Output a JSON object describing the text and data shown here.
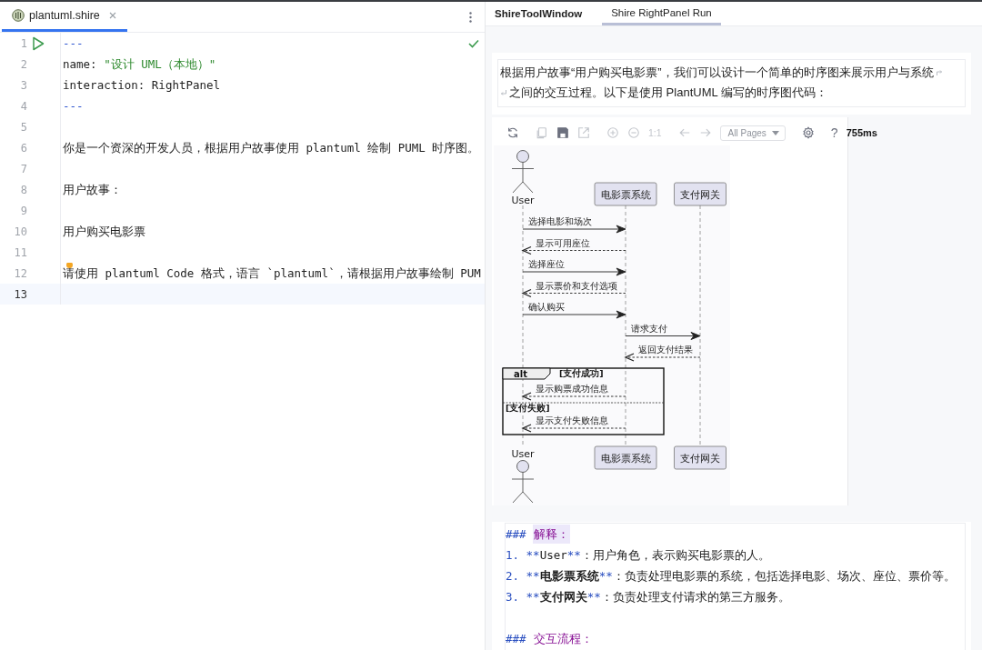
{
  "editor": {
    "tab": {
      "label": "plantuml.shire",
      "selected": true
    },
    "lines": [
      {
        "number": "1",
        "current": false,
        "run": true,
        "segments": [
          {
            "kind": "dashes",
            "text": "---"
          }
        ]
      },
      {
        "number": "2",
        "current": false,
        "run": false,
        "segments": [
          {
            "kind": "text",
            "text": "name: "
          },
          {
            "kind": "string",
            "text": "\"设计 UML（本地）\""
          }
        ]
      },
      {
        "number": "3",
        "current": false,
        "run": false,
        "segments": [
          {
            "kind": "text",
            "text": "interaction: RightPanel"
          }
        ]
      },
      {
        "number": "4",
        "current": false,
        "run": false,
        "segments": [
          {
            "kind": "dashes",
            "text": "---"
          }
        ]
      },
      {
        "number": "5",
        "current": false,
        "run": false
      },
      {
        "number": "6",
        "current": false,
        "run": false,
        "segments": [
          {
            "kind": "text",
            "text": "你是一个资深的开发人员，根据用户故事使用 plantuml 绘制 PUML 时序图。"
          }
        ]
      },
      {
        "number": "7",
        "current": false,
        "run": false
      },
      {
        "number": "8",
        "current": false,
        "run": false,
        "segments": [
          {
            "kind": "text",
            "text": "用户故事："
          }
        ]
      },
      {
        "number": "9",
        "current": false,
        "run": false
      },
      {
        "number": "10",
        "current": false,
        "run": false,
        "segments": [
          {
            "kind": "text",
            "text": "用户购买电影票"
          }
        ]
      },
      {
        "number": "11",
        "current": false,
        "run": false
      },
      {
        "number": "12",
        "current": false,
        "run": false,
        "segments": [
          {
            "kind": "text",
            "text": "请使用 plantuml Code 格式，语言 `plantuml`，请根据用户故事绘制 PUM"
          }
        ]
      },
      {
        "number": "13",
        "current": true,
        "run": false
      }
    ]
  },
  "panel": {
    "title": "ShireToolWindow",
    "tabs": [
      {
        "label": "Shire RightPanel Run",
        "selected": true
      }
    ],
    "message_lines": [
      "根据用户故事“用户购买电影票”，我们可以设计一个简单的时序图来展示用户与系统",
      "之间的交互过程。以下是使用 PlantUML 编写的时序图代码："
    ],
    "toolbar": [
      {
        "kind": "refresh",
        "disabled": false
      },
      {
        "kind": "separator"
      },
      {
        "kind": "copy",
        "disabled": true
      },
      {
        "kind": "save",
        "disabled": false
      },
      {
        "kind": "export",
        "disabled": true
      },
      {
        "kind": "separator"
      },
      {
        "kind": "zoom-in",
        "disabled": true
      },
      {
        "kind": "zoom-out",
        "disabled": true
      },
      {
        "kind": "text",
        "label": "1:1",
        "disabled": true
      },
      {
        "kind": "separator"
      },
      {
        "kind": "back",
        "disabled": true
      },
      {
        "kind": "forward",
        "disabled": true
      },
      {
        "kind": "dropdown",
        "label": "All Pages",
        "disabled": true
      },
      {
        "kind": "separator"
      },
      {
        "kind": "settings",
        "disabled": false
      },
      {
        "kind": "separator"
      },
      {
        "kind": "help",
        "label": "?",
        "disabled": false
      },
      {
        "kind": "time",
        "label": "755ms"
      }
    ],
    "diagram": {
      "participants": [
        {
          "kind": "actor",
          "name": "User",
          "footer_name": "User"
        },
        {
          "kind": "participant",
          "name": "电影票系统",
          "footer_name": "电影票系统"
        },
        {
          "kind": "participant",
          "name": "支付网关",
          "footer_name": "支付网关"
        }
      ],
      "sequence": [
        {
          "kind": "call",
          "label": "选择电影和场次"
        },
        {
          "kind": "return",
          "label": "显示可用座位"
        },
        {
          "kind": "call",
          "label": "选择座位"
        },
        {
          "kind": "return",
          "label": "显示票价和支付选项"
        },
        {
          "kind": "call",
          "label": "确认购买"
        },
        {
          "kind": "call",
          "label": "请求支付"
        },
        {
          "kind": "return",
          "label": "返回支付结果"
        },
        {
          "kind": "alt",
          "label": "alt",
          "branches": [
            {
              "guard": "[支付成功]",
              "messages": [
                {
                  "kind": "return",
                  "label": "显示购票成功信息"
                }
              ]
            },
            {
              "guard": "[支付失败]",
              "messages": [
                {
                  "kind": "return",
                  "label": "显示支付失败信息"
                }
              ]
            }
          ]
        }
      ]
    },
    "explanation": [
      {
        "kind": "line",
        "segments": [
          {
            "kind": "marker",
            "text": "###"
          },
          {
            "kind": "heading",
            "text": "解释：",
            "highlighted": true
          }
        ]
      },
      {
        "kind": "line",
        "segments": [
          {
            "kind": "marker",
            "text": "1. **"
          },
          {
            "kind": "text",
            "text": "User"
          },
          {
            "kind": "marker",
            "text": "**"
          },
          {
            "kind": "text",
            "text": "：用户角色，表示购买电影票的人。"
          }
        ]
      },
      {
        "kind": "line",
        "segments": [
          {
            "kind": "marker",
            "text": "2. **"
          },
          {
            "kind": "bold",
            "text": "电影票系统"
          },
          {
            "kind": "marker",
            "text": "**"
          },
          {
            "kind": "text",
            "text": "：负责处理电影票的系统，包括选择电影、场次、座位、票价等。"
          }
        ]
      },
      {
        "kind": "line",
        "segments": [
          {
            "kind": "marker",
            "text": "3. **"
          },
          {
            "kind": "bold",
            "text": "支付网关"
          },
          {
            "kind": "marker",
            "text": "**"
          },
          {
            "kind": "text",
            "text": "：负责处理支付请求的第三方服务。"
          }
        ]
      },
      {
        "kind": "blank"
      },
      {
        "kind": "line",
        "segments": [
          {
            "kind": "marker",
            "text": "###"
          },
          {
            "kind": "heading",
            "text": "交互流程：",
            "highlighted": false
          }
        ]
      }
    ]
  }
}
